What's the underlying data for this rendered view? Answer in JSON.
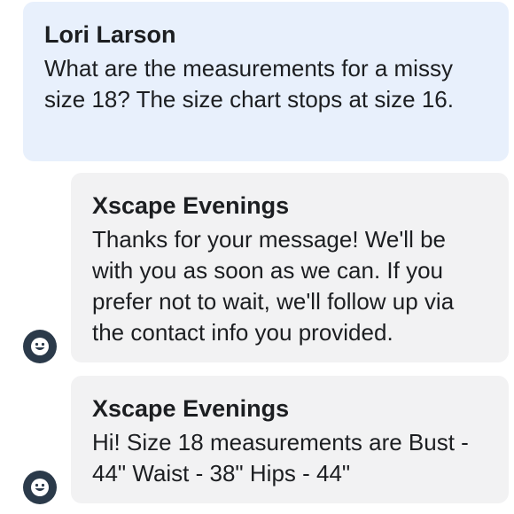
{
  "messages": [
    {
      "sender": "Lori Larson",
      "text": "What are the measurements for a missy size 18? The size chart stops at size 16."
    },
    {
      "sender": "Xscape Evenings",
      "text": "Thanks for your message! We'll be with you as soon as we can. If you prefer not to wait, we'll follow up via the contact info you provided."
    },
    {
      "sender": "Xscape Evenings",
      "text": "Hi! Size 18 measurements are Bust - 44\" Waist - 38\" Hips - 44\""
    }
  ],
  "avatars": [
    {
      "icon": "smiley-face-icon",
      "color": "#2b3a4a"
    },
    {
      "icon": "smiley-face-icon",
      "color": "#2b3a4a"
    }
  ],
  "colors": {
    "user_bubble": "#e8f0fc",
    "page_bubble": "#f2f2f3",
    "text": "#1c1e21"
  }
}
